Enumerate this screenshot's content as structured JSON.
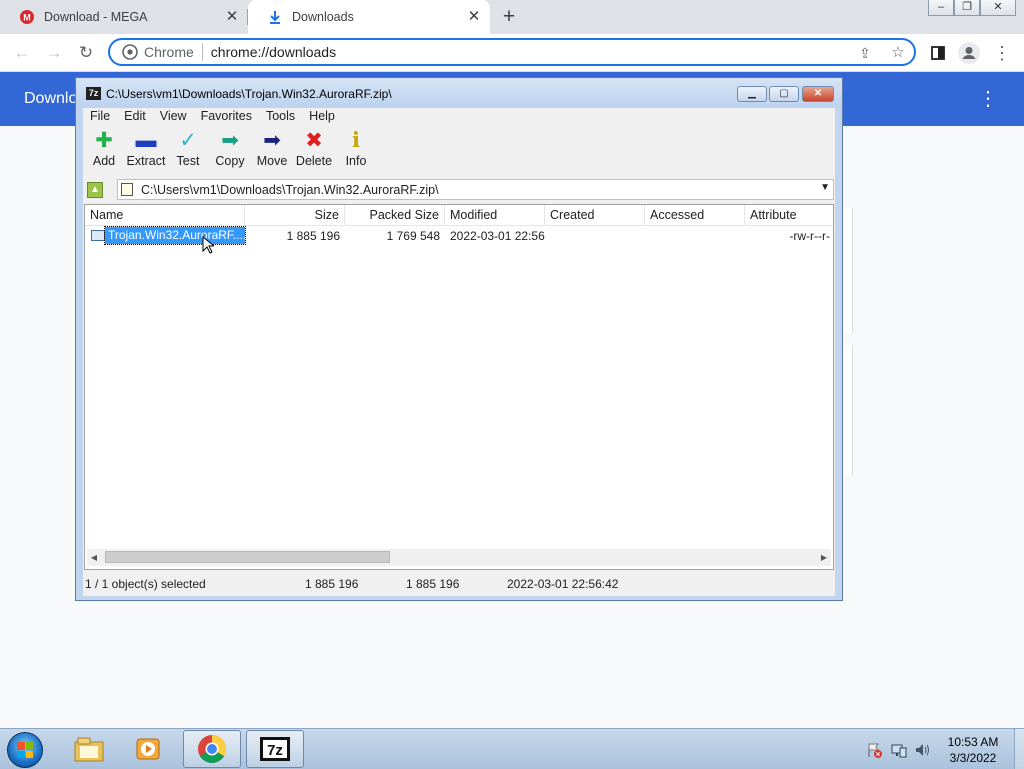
{
  "browser": {
    "tabs": [
      {
        "title": "Download - MEGA",
        "icon": "mega-icon",
        "active": false
      },
      {
        "title": "Downloads",
        "icon": "download-icon",
        "active": true
      }
    ],
    "omnibox": {
      "chip": "Chrome",
      "url": "chrome://downloads"
    },
    "page_title": "Downlo"
  },
  "sevenzip": {
    "title": "C:\\Users\\vm1\\Downloads\\Trojan.Win32.AuroraRF.zip\\",
    "menu": [
      "File",
      "Edit",
      "View",
      "Favorites",
      "Tools",
      "Help"
    ],
    "toolbar": [
      {
        "label": "Add",
        "icon": "add-icon",
        "glyph": "✚",
        "color": "#22b14c"
      },
      {
        "label": "Extract",
        "icon": "extract-icon",
        "glyph": "▬",
        "color": "#1f3fbf"
      },
      {
        "label": "Test",
        "icon": "test-icon",
        "glyph": "✓",
        "color": "#2fb5c5"
      },
      {
        "label": "Copy",
        "icon": "copy-icon",
        "glyph": "➡",
        "color": "#17a085"
      },
      {
        "label": "Move",
        "icon": "move-icon",
        "glyph": "➡",
        "color": "#1a237e"
      },
      {
        "label": "Delete",
        "icon": "delete-icon",
        "glyph": "✖",
        "color": "#e02020"
      },
      {
        "label": "Info",
        "icon": "info-icon",
        "glyph": "ℹ",
        "color": "#c9a400"
      }
    ],
    "address": "C:\\Users\\vm1\\Downloads\\Trojan.Win32.AuroraRF.zip\\",
    "columns": [
      "Name",
      "Size",
      "Packed Size",
      "Modified",
      "Created",
      "Accessed",
      "Attribute"
    ],
    "rows": [
      {
        "name": "Trojan.Win32.AuroraRF....",
        "size": "1 885 196",
        "packed": "1 769 548",
        "modified": "2022-03-01 22:56",
        "created": "",
        "accessed": "",
        "attributes": "-rw-r--r-"
      }
    ],
    "status": {
      "selection": "1 / 1 object(s) selected",
      "size": "1 885 196",
      "packed": "1 885 196",
      "modified": "2022-03-01 22:56:42"
    }
  },
  "taskbar": {
    "time": "10:53 AM",
    "date": "3/3/2022",
    "apps": [
      "explorer-icon",
      "media-player-icon",
      "chrome-icon",
      "7zip-icon"
    ]
  }
}
